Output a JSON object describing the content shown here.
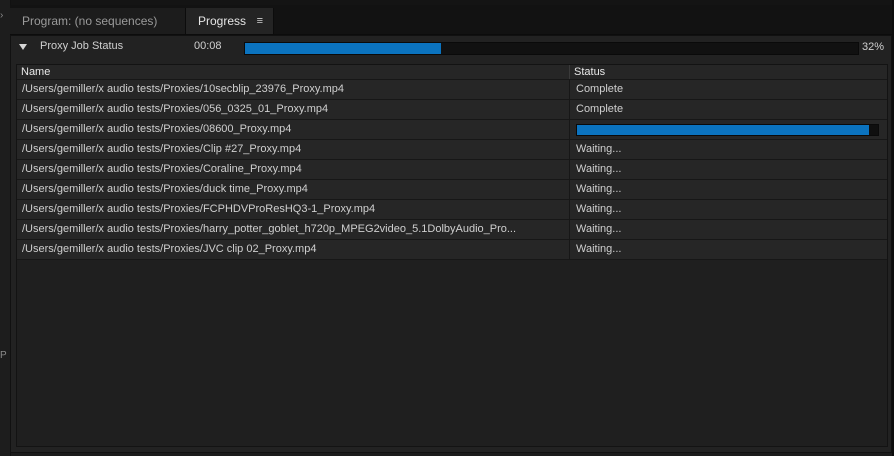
{
  "tabs": [
    {
      "label": "Program: (no sequences)"
    },
    {
      "label": "Progress",
      "menu_icon": "≡"
    }
  ],
  "job": {
    "label": "Proxy Job Status",
    "elapsed": "00:08",
    "percent_text": "32%",
    "progress": 0.32
  },
  "table": {
    "columns": {
      "name": "Name",
      "status": "Status"
    },
    "rows": [
      {
        "name": "/Users/gemiller/x audio tests/Proxies/10secblip_23976_Proxy.mp4",
        "status": "Complete"
      },
      {
        "name": "/Users/gemiller/x audio tests/Proxies/056_0325_01_Proxy.mp4",
        "status": "Complete"
      },
      {
        "name": "/Users/gemiller/x audio tests/Proxies/08600_Proxy.mp4",
        "status": "",
        "progress": 0.97
      },
      {
        "name": "/Users/gemiller/x audio tests/Proxies/Clip #27_Proxy.mp4",
        "status": "Waiting..."
      },
      {
        "name": "/Users/gemiller/x audio tests/Proxies/Coraline_Proxy.mp4",
        "status": "Waiting..."
      },
      {
        "name": "/Users/gemiller/x audio tests/Proxies/duck time_Proxy.mp4",
        "status": "Waiting..."
      },
      {
        "name": "/Users/gemiller/x audio tests/Proxies/FCPHDVProResHQ3-1_Proxy.mp4",
        "status": "Waiting..."
      },
      {
        "name": "/Users/gemiller/x audio tests/Proxies/harry_potter_goblet_h720p_MPEG2video_5.1DolbyAudio_Pro...",
        "status": "Waiting..."
      },
      {
        "name": "/Users/gemiller/x audio tests/Proxies/JVC clip 02_Proxy.mp4",
        "status": "Waiting..."
      }
    ]
  },
  "colors": {
    "progress_fill": "#0b73bf",
    "panel_bg": "#222222"
  }
}
